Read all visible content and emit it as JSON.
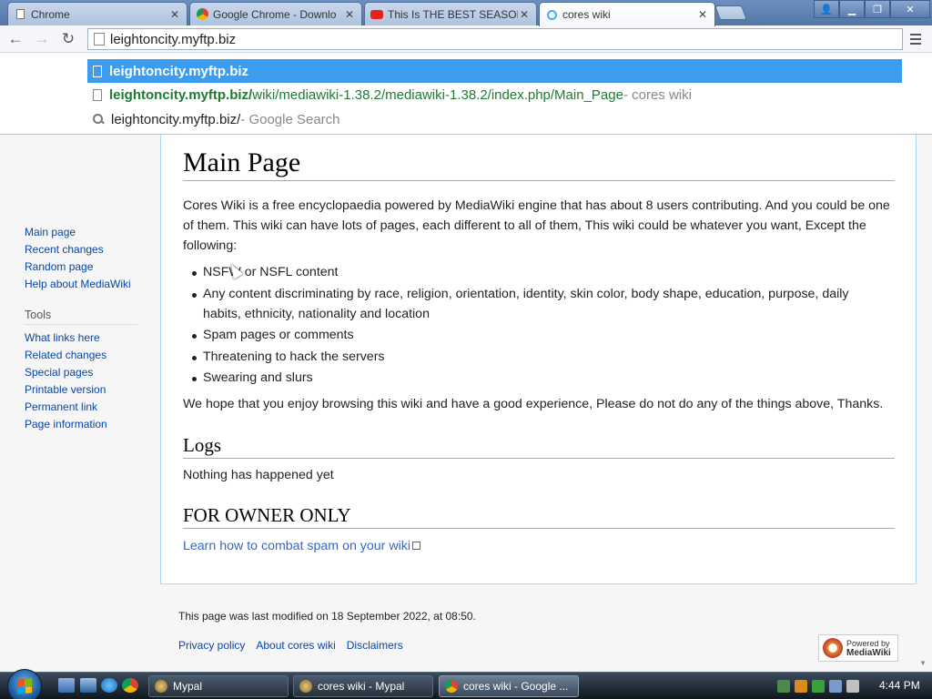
{
  "browser": {
    "tabs": [
      {
        "label": "Chrome",
        "icon": "page-icon"
      },
      {
        "label": "Google Chrome - Downlo",
        "icon": "chrome-icon"
      },
      {
        "label": "This Is THE BEST SEASON",
        "icon": "youtube-icon"
      },
      {
        "label": "cores wiki",
        "icon": "wiki-loading-icon"
      }
    ],
    "address": "leightoncity.myftp.biz",
    "suggestions": [
      {
        "bold": "leightoncity.myftp.biz",
        "rest": "",
        "suffix": ""
      },
      {
        "bold": "leightoncity.myftp.biz/",
        "rest": "wiki/mediawiki-1.38.2/mediawiki-1.38.2/index.php/Main_Page",
        "suffix": " - cores wiki"
      },
      {
        "bold": "",
        "rest": "leightoncity.myftp.biz/",
        "suffix": " - Google Search"
      }
    ]
  },
  "sidebar": {
    "nav": [
      "Main page",
      "Recent changes",
      "Random page",
      "Help about MediaWiki"
    ],
    "tools_heading": "Tools",
    "tools": [
      "What links here",
      "Related changes",
      "Special pages",
      "Printable version",
      "Permanent link",
      "Page information"
    ]
  },
  "page": {
    "title": "Main Page",
    "intro": "Cores Wiki is a free encyclopaedia powered by MediaWiki engine that has about 8 users contributing. And you could be one of them. This wiki can have lots of pages, each different to all of them, This wiki could be whatever you want, Except the following:",
    "rules": [
      "NSFW or NSFL content",
      "Any content discriminating by race, religion, orientation, identity, skin color, body shape, education, purpose, daily habits, ethnicity, nationality and location",
      "Spam pages or comments",
      "Threatening to hack the servers",
      "Swearing and slurs"
    ],
    "outro": "We hope that you enjoy browsing this wiki and have a good experience, Please do not do any of the things above, Thanks.",
    "logs_heading": "Logs",
    "logs_text": "Nothing has happened yet",
    "owner_heading": "FOR OWNER ONLY",
    "owner_link": "Learn how to combat spam on your wiki"
  },
  "footer": {
    "last_modified": "This page was last modified on 18 September 2022, at 08:50.",
    "links": [
      "Privacy policy",
      "About cores wiki",
      "Disclaimers"
    ],
    "powered_small": "Powered by",
    "powered_big": "MediaWiki"
  },
  "taskbar": {
    "buttons": [
      "Mypal",
      "cores wiki - Mypal",
      "cores wiki - Google ..."
    ],
    "clock": "4:44 PM"
  },
  "colors": {
    "accent": "#3b9cf0",
    "link": "#0645ad",
    "wiki_link": "#36c"
  }
}
